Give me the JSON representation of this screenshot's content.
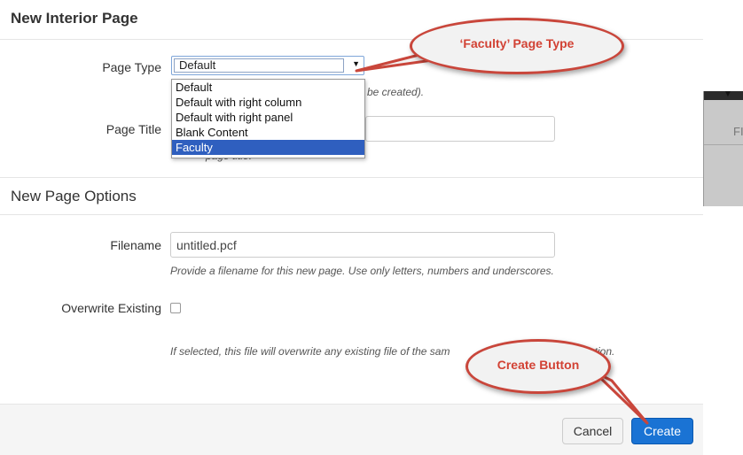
{
  "modal": {
    "title": "New Interior Page",
    "page_type": {
      "label": "Page Type",
      "selected_value": "Default",
      "options": [
        "Default",
        "Default with right column",
        "Default with right panel",
        "Blank Content",
        "Faculty"
      ],
      "highlighted_option": "Faculty",
      "help_partial": "be created).",
      "help_partial2": "ppear ...page ... title."
    },
    "page_title": {
      "label": "Page Title",
      "value": ""
    },
    "section": {
      "title": "New Page Options"
    },
    "filename": {
      "label": "Filename",
      "value": "untitled.pcf",
      "help": "Provide a filename for this new page. Use only letters, numbers and underscores."
    },
    "overwrite": {
      "label": "Overwrite Existing",
      "checked": false,
      "help": "If selected, this file will overwrite any existing file of the sam",
      "help_tail": "ation."
    },
    "footer": {
      "cancel_label": "Cancel",
      "create_label": "Create"
    }
  },
  "background_window": {
    "text": "FI"
  },
  "callouts": {
    "faculty": "‘Faculty’ Page Type",
    "create": "Create Button",
    "color": "#d24234"
  }
}
